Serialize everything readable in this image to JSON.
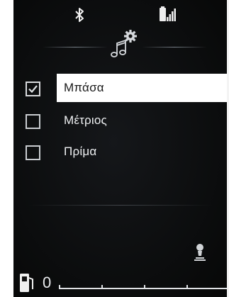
{
  "header": {
    "icons": [
      "bluetooth-icon",
      "phone-signal-icon",
      "audio-settings-icon"
    ]
  },
  "options": [
    {
      "label": "Μπάσα",
      "checked": true,
      "selected": true
    },
    {
      "label": "Μέτριος",
      "checked": false,
      "selected": false
    },
    {
      "label": "Πρίμα",
      "checked": false,
      "selected": false
    }
  ],
  "footer": {
    "fuel_label": "0",
    "icons": [
      "fuel-pump-icon",
      "seat-icon"
    ]
  },
  "colors": {
    "background": "#080909",
    "text": "#eef0f2",
    "selection": "#ffffff"
  }
}
